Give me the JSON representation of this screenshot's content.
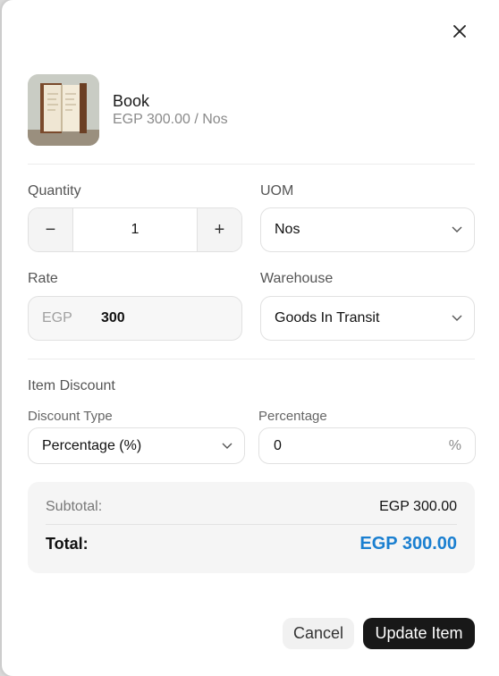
{
  "item": {
    "name": "Book",
    "price_line": "EGP 300.00 / Nos",
    "image_icon": "book-photo"
  },
  "quantity": {
    "label": "Quantity",
    "value": "1",
    "minus": "−",
    "plus": "+"
  },
  "uom": {
    "label": "UOM",
    "selected": "Nos"
  },
  "rate": {
    "label": "Rate",
    "currency": "EGP",
    "value": "300"
  },
  "warehouse": {
    "label": "Warehouse",
    "selected": "Goods In Transit"
  },
  "discount": {
    "section_label": "Item Discount",
    "type_label": "Discount Type",
    "type_selected": "Percentage (%)",
    "percentage_label": "Percentage",
    "percentage_value": "0",
    "percent_sign": "%"
  },
  "summary": {
    "subtotal_label": "Subtotal:",
    "subtotal_value": "EGP 300.00",
    "total_label": "Total:",
    "total_value": "EGP 300.00"
  },
  "actions": {
    "cancel": "Cancel",
    "update": "Update Item"
  },
  "colors": {
    "accent_total": "#1a7fd0",
    "primary_button": "#181818"
  }
}
